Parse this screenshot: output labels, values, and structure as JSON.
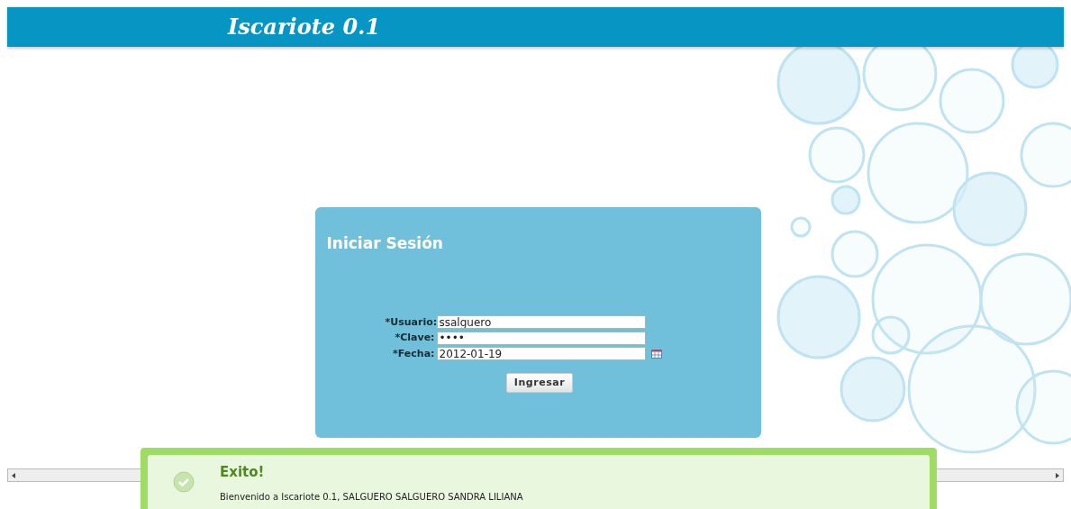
{
  "header": {
    "logo": "Iscariote 0.1"
  },
  "login": {
    "title": "Iniciar Sesión",
    "fields": [
      {
        "label": "*Usuario:",
        "value": "ssalguero",
        "kind": "text"
      },
      {
        "label": "*Clave:",
        "value": "••••",
        "kind": "password"
      },
      {
        "label": "*Fecha:",
        "value": "2012-01-19",
        "kind": "date"
      }
    ],
    "button": "Ingresar"
  },
  "notification": {
    "title": "Exito!",
    "message": "Bienvenido a Iscariote 0.1, SALGUERO SALGUERO SANDRA LILIANA"
  }
}
